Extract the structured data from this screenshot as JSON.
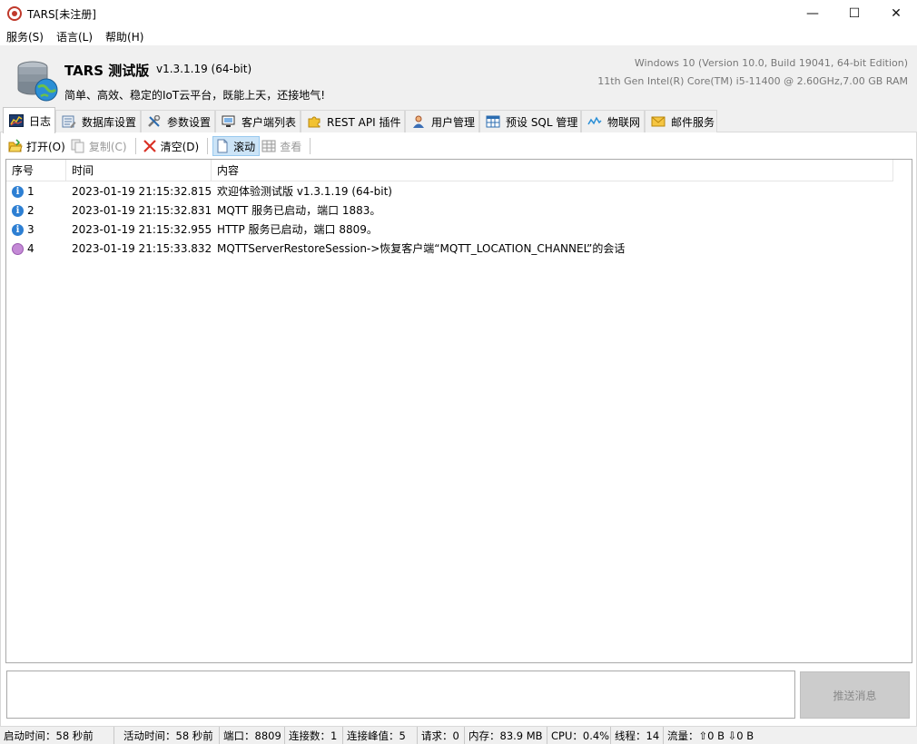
{
  "window": {
    "title": "TARS[未注册]",
    "controls": [
      "—",
      "☐",
      "✕"
    ]
  },
  "menu": [
    {
      "label": "服务(S)"
    },
    {
      "label": "语言(L)"
    },
    {
      "label": "帮助(H)"
    }
  ],
  "header": {
    "brand": "TARS 测试版",
    "version": "v1.3.1.19 (64-bit)",
    "slogan": "简单、高效、稳定的IoT云平台，既能上天，还接地气!",
    "os_info": "Windows 10 (Version 10.0, Build 19041, 64-bit Edition)",
    "cpu_info": "11th Gen Intel(R) Core(TM) i5-11400 @ 2.60GHz,7.00 GB RAM"
  },
  "tabs": [
    {
      "label": "日志",
      "icon": "log-chart-icon",
      "active": true
    },
    {
      "label": "数据库设置",
      "icon": "database-settings-icon"
    },
    {
      "label": "参数设置",
      "icon": "tools-icon"
    },
    {
      "label": "客户端列表",
      "icon": "monitor-icon"
    },
    {
      "label": "REST API 插件",
      "icon": "puzzle-icon"
    },
    {
      "label": "用户管理",
      "icon": "user-icon"
    },
    {
      "label": "预设 SQL 管理",
      "icon": "table-icon"
    },
    {
      "label": "物联网",
      "icon": "signal-icon"
    },
    {
      "label": "邮件服务",
      "icon": "mail-icon"
    }
  ],
  "toolbar": {
    "open": "打开(O)",
    "copy": "复制(C)",
    "clear": "清空(D)",
    "scroll": "滚动",
    "view": "查看"
  },
  "log_table": {
    "columns": [
      "序号",
      "时间",
      "内容"
    ],
    "rows": [
      {
        "level": "info",
        "no": "1",
        "time": "2023-01-19 21:15:32.815",
        "content": "欢迎体验测试版 v1.3.1.19 (64-bit)"
      },
      {
        "level": "info",
        "no": "2",
        "time": "2023-01-19 21:15:32.831",
        "content": "MQTT 服务已启动，端口 1883。"
      },
      {
        "level": "info",
        "no": "3",
        "time": "2023-01-19 21:15:32.955",
        "content": "HTTP 服务已启动，端口 8809。"
      },
      {
        "level": "debug",
        "no": "4",
        "time": "2023-01-19 21:15:33.832",
        "content": "MQTTServerRestoreSession->恢复客户端“MQTT_LOCATION_CHANNEL”的会话"
      }
    ]
  },
  "message": {
    "input_value": "",
    "send_label": "推送消息"
  },
  "status": {
    "uptime": "启动时间：58 秒前",
    "active": "活动时间：58 秒前",
    "port": "端口：8809",
    "connections": "连接数：1",
    "peak": "连接峰值：5",
    "requests": "请求：0",
    "memory": "内存：83.9 MB",
    "cpu": "CPU：0.4%",
    "threads": "线程：14",
    "traffic": "流量：⇧0 B  ⇩0 B"
  },
  "colors": {
    "info": "#2d7fd3",
    "debug": "#c48ad6",
    "selected_tool": "#cce4f7"
  }
}
